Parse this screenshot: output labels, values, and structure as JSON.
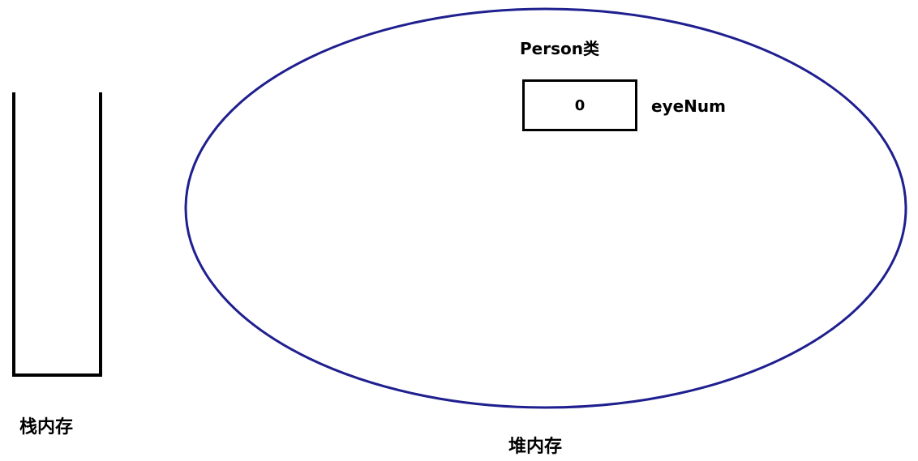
{
  "stack": {
    "label": "栈内存",
    "stroke_color": "#000000"
  },
  "heap": {
    "label": "堆内存",
    "stroke_color": "#1f1f8f",
    "class_label": "Person类",
    "field": {
      "value": "0",
      "name": "eyeNum"
    }
  }
}
